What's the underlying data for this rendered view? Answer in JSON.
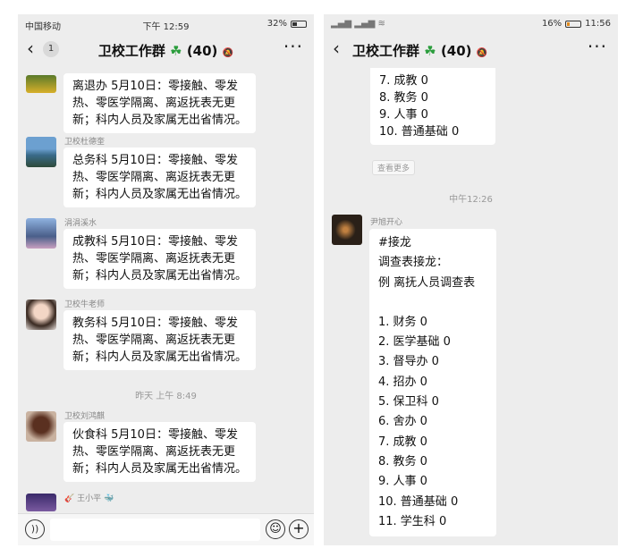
{
  "left": {
    "status": {
      "carrier": "中国移动",
      "time": "下午 12:59",
      "battery": "32%"
    },
    "nav": {
      "back_count": "1",
      "title": "卫校工作群",
      "count": "(40)"
    },
    "messages": [
      {
        "sender": "",
        "lines": [
          "离退办 5月10日：零接触、零发",
          "热、零医学隔离、离返抚表无更",
          "新；科内人员及家属无出省情况。"
        ]
      },
      {
        "sender": "卫校杜德奎",
        "lines": [
          "总务科 5月10日：零接触、零发",
          "热、零医学隔离、离返抚表无更",
          "新；科内人员及家属无出省情况。"
        ]
      },
      {
        "sender": "涓涓溪水",
        "lines": [
          "成教科 5月10日：零接触、零发",
          "热、零医学隔离、离返抚表无更",
          "新；科内人员及家属无出省情况。"
        ]
      },
      {
        "sender": "卫校牛老师",
        "lines": [
          "教务科 5月10日：零接触、零发",
          "热、零医学隔离、离返抚表无更",
          "新；科内人员及家属无出省情况。"
        ]
      },
      {
        "sender": "卫校刘鸿麒",
        "lines": [
          "伙食科 5月10日：零接触、零发",
          "热、零医学隔离、离返抚表无更",
          "新；科内人员及家属无出省情况。"
        ]
      }
    ],
    "time_divider": "昨天 上午 8:49",
    "last_sender": "王小平"
  },
  "right": {
    "status": {
      "battery": "16%",
      "time": "11:56"
    },
    "nav": {
      "title": "卫校工作群",
      "count": "(40)"
    },
    "top_lines": [
      "7. 成教 0",
      "8. 教务 0",
      "9. 人事 0",
      "10. 普通基础 0"
    ],
    "view_more": "查看更多",
    "time_divider": "中午12:26",
    "sender": "尹旭开心",
    "lines": [
      "#接龙",
      "调查表接龙：",
      "例 离抚人员调查表",
      "",
      "1. 财务 0",
      "2. 医学基础 0",
      "3. 督导办 0",
      "4. 招办 0",
      "5. 保卫科 0",
      "6. 舍办 0",
      "7. 成教 0",
      "8. 教务 0",
      "9. 人事 0",
      "10. 普通基础 0",
      "11. 学生科 0"
    ]
  },
  "colors": {
    "chat_bg": "#ededed",
    "bubble": "#ffffff",
    "clover": "#2a9d3c"
  },
  "icons": [
    "back-icon",
    "more-icon",
    "voice-icon",
    "emoji-icon",
    "plus-icon",
    "clover-icon"
  ]
}
